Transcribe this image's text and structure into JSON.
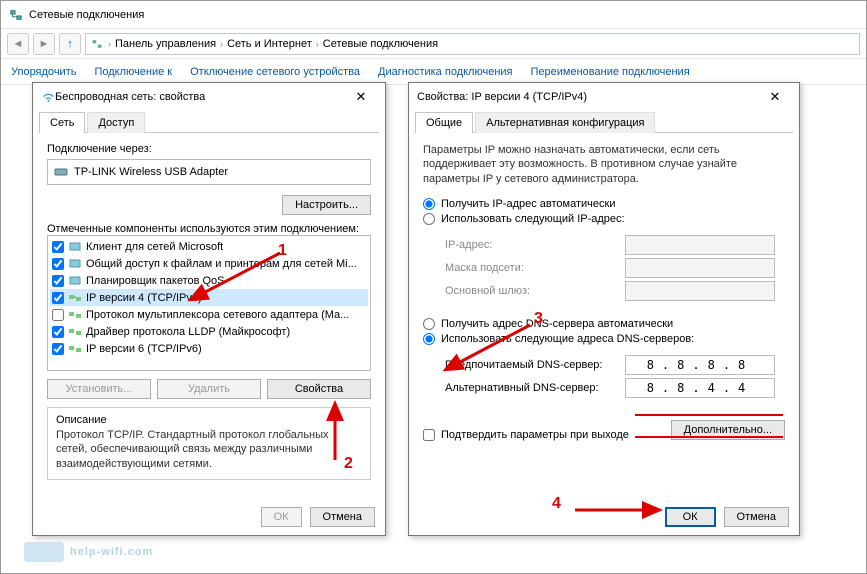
{
  "outerWindow": {
    "title": "Сетевые подключения"
  },
  "breadcrumb": {
    "root": "Панель управления",
    "seg1": "Сеть и Интернет",
    "seg2": "Сетевые подключения"
  },
  "toolbar": {
    "organize": "Упорядочить",
    "connect": "Подключение к",
    "disable": "Отключение сетевого устройства",
    "diagnose": "Диагностика подключения",
    "rename": "Переименование подключения"
  },
  "dlg1": {
    "title": "Беспроводная сеть: свойства",
    "tabs": {
      "net": "Сеть",
      "access": "Доступ"
    },
    "connectVia": "Подключение через:",
    "adapter": "TP-LINK Wireless USB Adapter",
    "configureBtn": "Настроить...",
    "compLabel": "Отмеченные компоненты используются этим подключением:",
    "items": [
      "Клиент для сетей Microsoft",
      "Общий доступ к файлам и принтерам для сетей Mi...",
      "Планировщик пакетов QoS",
      "IP версии 4 (TCP/IPv4)",
      "Протокол мультиплексора сетевого адаптера (Ма...",
      "Драйвер протокола LLDP (Майкрософт)",
      "IP версии 6 (TCP/IPv6)"
    ],
    "installBtn": "Установить...",
    "removeBtn": "Удалить",
    "propsBtn": "Свойства",
    "descLabel": "Описание",
    "descText": "Протокол TCP/IP. Стандартный протокол глобальных сетей, обеспечивающий связь между различными взаимодействующими сетями.",
    "ok": "ОК",
    "cancel": "Отмена"
  },
  "dlg2": {
    "title": "Свойства: IP версии 4 (TCP/IPv4)",
    "tabs": {
      "general": "Общие",
      "alt": "Альтернативная конфигурация"
    },
    "intro": "Параметры IP можно назначать автоматически, если сеть поддерживает эту возможность. В противном случае узнайте параметры IP у сетевого администратора.",
    "ipAuto": "Получить IP-адрес автоматически",
    "ipManual": "Использовать следующий IP-адрес:",
    "ipAddr": "IP-адрес:",
    "mask": "Маска подсети:",
    "gateway": "Основной шлюз:",
    "dnsAuto": "Получить адрес DNS-сервера автоматически",
    "dnsManual": "Использовать следующие адреса DNS-серверов:",
    "dnsPref": "Предпочитаемый DNS-сервер:",
    "dnsAlt": "Альтернативный DNS-сервер:",
    "dnsPrefVal": "8.8.8.8",
    "dnsAltVal": "8.8.4.4",
    "validate": "Подтвердить параметры при выходе",
    "advanced": "Дополнительно...",
    "ok": "ОК",
    "cancel": "Отмена"
  },
  "annotations": {
    "n1": "1",
    "n2": "2",
    "n3": "3",
    "n4": "4"
  },
  "watermark": "help-wifi.com"
}
